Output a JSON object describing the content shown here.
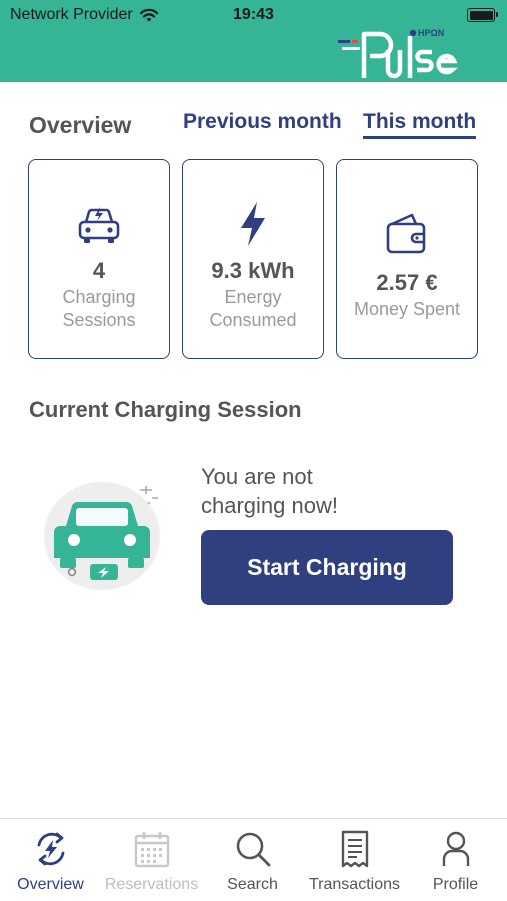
{
  "status_bar": {
    "carrier": "Network Provider",
    "time": "19:43"
  },
  "brand": {
    "name": "Pulse",
    "sub": "ΗΡΩΝ",
    "primary_color": "#35b596",
    "accent_color": "#2f3f80"
  },
  "overview": {
    "title": "Overview",
    "tabs": [
      {
        "label": "Previous month",
        "active": false
      },
      {
        "label": "This month",
        "active": true
      }
    ],
    "cards": [
      {
        "icon": "car-charging-icon",
        "value": "4",
        "label": "Charging Sessions"
      },
      {
        "icon": "lightning-bolt-icon",
        "value": "9.3 kWh",
        "label": "Energy Consumed"
      },
      {
        "icon": "wallet-icon",
        "value": "2.57 €",
        "label": "Money Spent"
      }
    ]
  },
  "current_session": {
    "title": "Current Charging Session",
    "message": "You are not charging now!",
    "button_label": "Start Charging"
  },
  "tabbar": {
    "items": [
      {
        "label": "Overview",
        "icon": "overview-icon",
        "state": "active"
      },
      {
        "label": "Reservations",
        "icon": "calendar-icon",
        "state": "disabled"
      },
      {
        "label": "Search",
        "icon": "search-icon",
        "state": "normal"
      },
      {
        "label": "Transactions",
        "icon": "receipt-icon",
        "state": "normal"
      },
      {
        "label": "Profile",
        "icon": "profile-icon",
        "state": "normal"
      }
    ]
  }
}
